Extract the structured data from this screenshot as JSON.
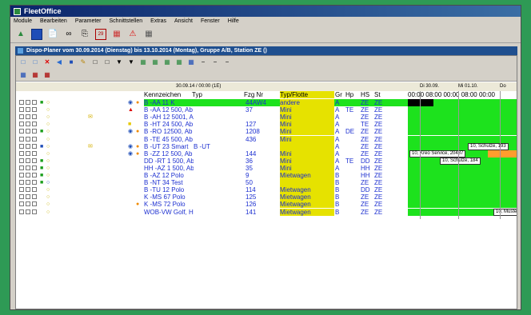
{
  "window": {
    "title": "FleetOffice"
  },
  "menu": [
    "Module",
    "Bearbeiten",
    "Parameter",
    "Schnittstellen",
    "Extras",
    "Ansicht",
    "Fenster",
    "Hilfe"
  ],
  "toolbar_icons": [
    "module-icon",
    "save-icon",
    "document-icon",
    "link-icon",
    "print-icon",
    "calendar-icon",
    "report-icon",
    "warning-icon",
    "grid-icon"
  ],
  "child": {
    "title": "Dispo-Planer vom 30.09.2014 (Dienstag) bis 13.10.2014 (Montag), Gruppe A/B, Station ZE ()"
  },
  "timeline": {
    "current": "30.09.14 / 00:00 (1E)",
    "days": [
      "Di 30.09.",
      "Mi 01.10.",
      "Do"
    ]
  },
  "headers": [
    "Kennzeichen",
    "Typ",
    "Fzg Nr",
    "Typ/Flotte",
    "Gr",
    "Hp",
    "HS",
    "St"
  ],
  "time_header": "00:00 08:00 00:00 08:00 00:00",
  "rows": [
    {
      "plate": "B -AA 11 K",
      "type": "",
      "nr": "44AW4",
      "fleet": "andere",
      "gr": "A",
      "hp": "",
      "hs": "ZE",
      "st": "ZE"
    },
    {
      "plate": "B -AA 12 500, Ab",
      "type": "",
      "nr": "37",
      "fleet": "Mini",
      "gr": "A",
      "hp": "TE",
      "hs": "ZE",
      "st": "ZE"
    },
    {
      "plate": "B -AH 12 5001, Al",
      "type": "",
      "nr": "",
      "fleet": "Mini",
      "gr": "A",
      "hp": "",
      "hs": "ZE",
      "st": "ZE"
    },
    {
      "plate": "B -HT 24 500, Ab",
      "type": "",
      "nr": "127",
      "fleet": "Mini",
      "gr": "A",
      "hp": "",
      "hs": "TE",
      "st": "ZE"
    },
    {
      "plate": "B -RO 12500, Ab",
      "type": "",
      "nr": "1208",
      "fleet": "Mini",
      "gr": "A",
      "hp": "DE",
      "hs": "ZE",
      "st": "ZE"
    },
    {
      "plate": "B -TE 45 500, Ab",
      "type": "",
      "nr": "436",
      "fleet": "Mini",
      "gr": "A",
      "hp": "",
      "hs": "ZE",
      "st": "ZE"
    },
    {
      "plate": "B -UT 23 Smart",
      "type": "B -UT",
      "nr": "",
      "fleet": "",
      "gr": "A",
      "hp": "",
      "hs": "ZE",
      "st": "ZE"
    },
    {
      "plate": "B -ZZ 12 500, Ab",
      "type": "",
      "nr": "144",
      "fleet": "Mini",
      "gr": "A",
      "hp": "",
      "hs": "ZE",
      "st": "ZE"
    },
    {
      "plate": "DD -RT 1 500, Ab",
      "type": "",
      "nr": "36",
      "fleet": "Mini",
      "gr": "A",
      "hp": "TE",
      "hs": "DD",
      "st": "ZE"
    },
    {
      "plate": "HH -AZ 1 500, Ab",
      "type": "",
      "nr": "35",
      "fleet": "Mini",
      "gr": "A",
      "hp": "",
      "hs": "HH",
      "st": "ZE"
    },
    {
      "plate": "B -AZ 12 Polo",
      "type": "",
      "nr": "9",
      "fleet": "Mietwagen",
      "gr": "B",
      "hp": "",
      "hs": "HH",
      "st": "ZE"
    },
    {
      "plate": "B -NT 34 Test",
      "type": "",
      "nr": "50",
      "fleet": "",
      "gr": "B",
      "hp": "",
      "hs": "ZE",
      "st": "ZE"
    },
    {
      "plate": "B -TU 12 Polo",
      "type": "",
      "nr": "114",
      "fleet": "Mietwagen",
      "gr": "B",
      "hp": "",
      "hs": "DD",
      "st": "ZE"
    },
    {
      "plate": "K -MS 67 Polo",
      "type": "",
      "nr": "125",
      "fleet": "Mietwagen",
      "gr": "B",
      "hp": "",
      "hs": "ZE",
      "st": "ZE"
    },
    {
      "plate": "K -MS 72 Polo",
      "type": "",
      "nr": "126",
      "fleet": "Mietwagen",
      "gr": "B",
      "hp": "",
      "hs": "ZE",
      "st": "ZE"
    },
    {
      "plate": "WOB-VW Golf, Hi",
      "type": "",
      "nr": "141",
      "fleet": "Mietwagen",
      "gr": "B",
      "hp": "",
      "hs": "ZE",
      "st": "ZE"
    }
  ],
  "bookings": [
    {
      "row": 6,
      "label": "10, Schulze, 193",
      "color": "#ffffff"
    },
    {
      "row": 7,
      "label": "10, Kreo Service, 20487",
      "color": "#ffffff"
    },
    {
      "row": 8,
      "label": "10, Schulze, 184",
      "color": "#ffffff"
    },
    {
      "row": 15,
      "label": "10, Muster",
      "color": "#ffffff"
    }
  ],
  "colors": {
    "available": "#1de21d",
    "fleet_highlight": "#e6e200",
    "link": "#1c2fd0",
    "booking_orange": "#ff9d2e"
  }
}
